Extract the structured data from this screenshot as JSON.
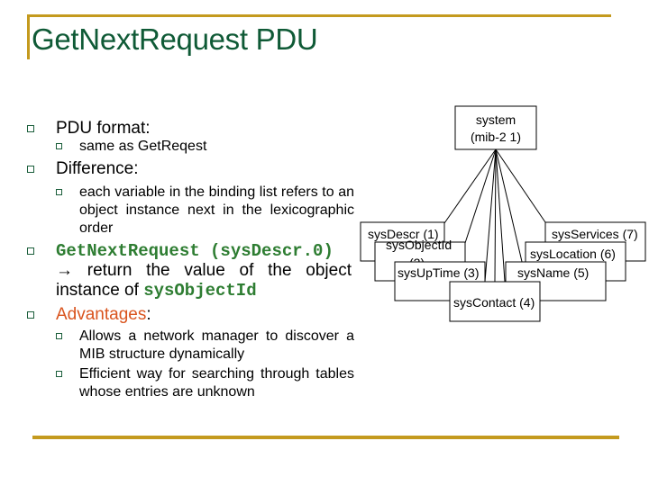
{
  "slide": {
    "title": "GetNextRequest PDU",
    "accent_color": "#c49a1e",
    "title_color": "#0f5a36"
  },
  "bullets": {
    "pdu_format": "PDU format:",
    "pdu_format_sub": "same as GetReqest",
    "difference": "Difference:",
    "difference_sub": "each variable in the binding list refers to an object instance next in the lexicographic order",
    "example_call": "GetNextRequest (sysDescr.0)",
    "example_arrow": "→",
    "example_text": "return the value of the object instance of",
    "example_obj": "sysObjectId",
    "advantages": "Advantages",
    "advantages_colon": ":",
    "advantages_sub": [
      "Allows a network manager to discover a MIB structure dynamically",
      "Efficient way for searching through tables whose entries are unknown"
    ]
  },
  "diagram": {
    "root": {
      "line1": "system",
      "line2": "(mib-2 1)"
    },
    "children": [
      {
        "label": "sysDescr (1)"
      },
      {
        "label": "sysObjectId",
        "label2": "(2)"
      },
      {
        "label": "sysUpTime (3)"
      },
      {
        "label": "sysContact (4)"
      },
      {
        "label": "sysName (5)"
      },
      {
        "label": "sysLocation (6)"
      },
      {
        "label": "sysServices (7)"
      }
    ]
  }
}
